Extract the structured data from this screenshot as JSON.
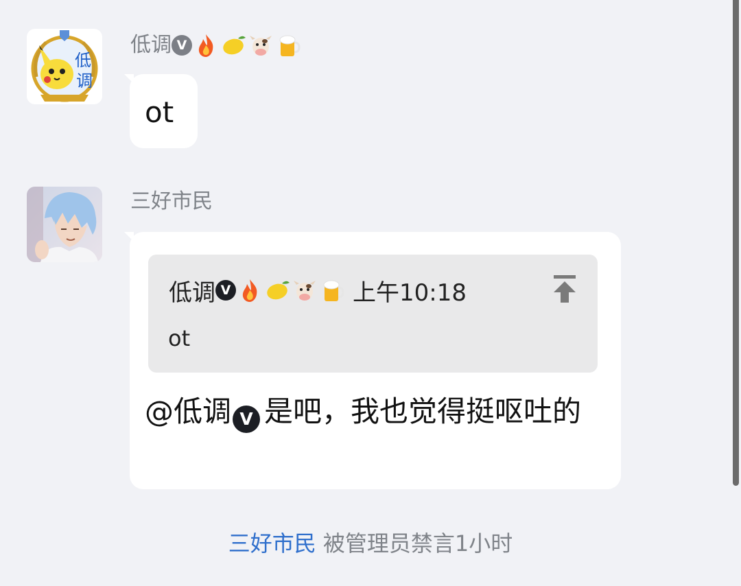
{
  "messages": [
    {
      "sender": "低调",
      "badge": "V",
      "emojis": [
        "fire-emoji",
        "lemon-emoji",
        "cow-emoji",
        "beer-emoji"
      ],
      "text": "ot"
    },
    {
      "sender": "三好市民",
      "quote": {
        "sender": "低调",
        "badge": "V",
        "emojis": [
          "fire-emoji",
          "lemon-emoji",
          "cow-emoji",
          "beer-emoji"
        ],
        "time": "上午10:18",
        "text": "ot"
      },
      "reply": {
        "mention": "@低调",
        "badge": "V",
        "text": "是吧，我也觉得挺呕吐的"
      }
    }
  ],
  "system_notice": {
    "user": "三好市民",
    "text": "被管理员禁言1小时"
  },
  "colors": {
    "background": "#f1f2f6",
    "bubble": "#ffffff",
    "quote_bg": "#e9e9ea",
    "link": "#2f6fcc",
    "muted": "#7f8389"
  }
}
